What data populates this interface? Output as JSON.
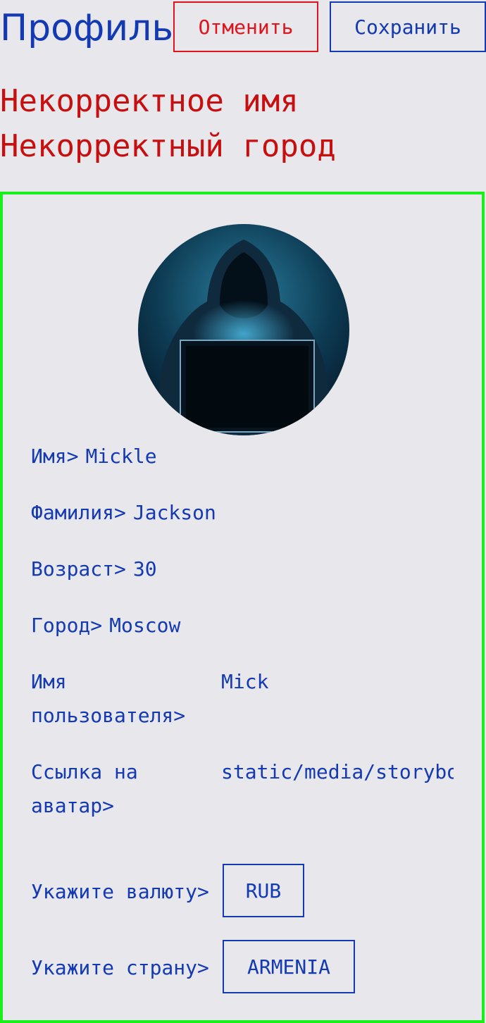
{
  "header": {
    "title": "Профиль",
    "cancel_label": "Отменить",
    "save_label": "Сохранить"
  },
  "errors": [
    "Некорректное имя",
    "Некорректный город"
  ],
  "profile": {
    "first_name_label": "Имя>",
    "first_name": "Mickle",
    "last_name_label": "Фамилия>",
    "last_name": "Jackson",
    "age_label": "Возраст>",
    "age": "30",
    "city_label": "Город>",
    "city": "Moscow",
    "username_label": "Имя пользователя>",
    "username": "Mick",
    "avatar_label": "Ссылка на аватар>",
    "avatar_link": "static/media/storybook.jpg",
    "currency_label": "Укажите валюту>",
    "currency": "RUB",
    "country_label": "Укажите страну>",
    "country": "ARMENIA"
  },
  "colors": {
    "primary": "#1339b3",
    "danger": "#e0141c",
    "error_text": "#c80f10",
    "card_border": "#19f019",
    "background": "#e8e7eb"
  }
}
